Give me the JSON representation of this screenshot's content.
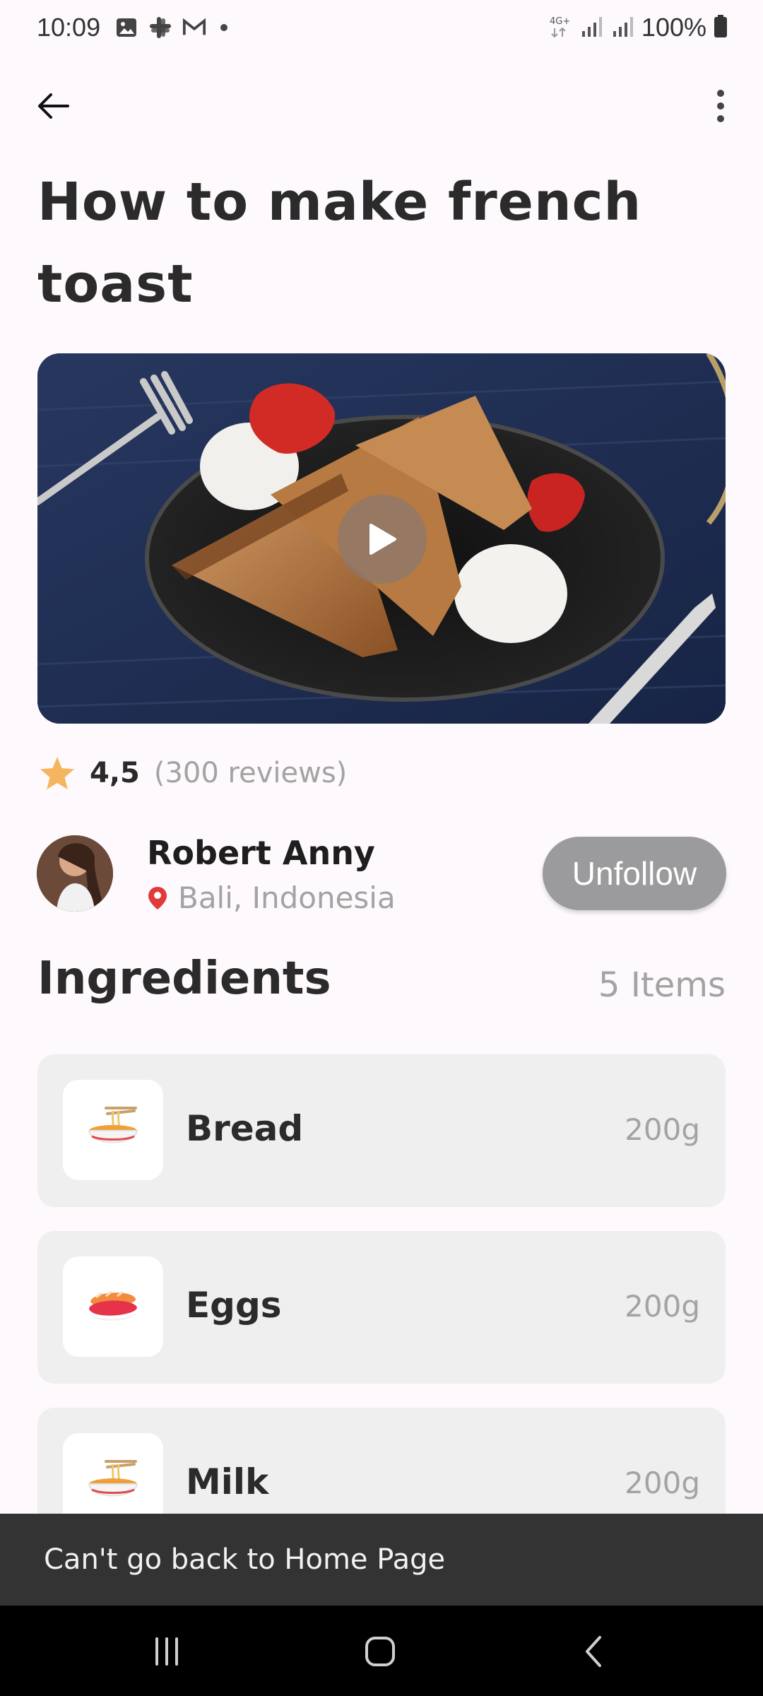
{
  "status_bar": {
    "time": "10:09",
    "left_icons": [
      "image-icon",
      "slack-icon",
      "gmail-icon",
      "dot-icon"
    ],
    "network": "4G+",
    "battery": "100%"
  },
  "recipe": {
    "title": "How to make french toast",
    "rating": "4,5",
    "reviews": "(300 reviews)"
  },
  "author": {
    "name": "Robert Anny",
    "location": "Bali, Indonesia",
    "follow_label": "Unfollow"
  },
  "ingredients": {
    "title": "Ingredients",
    "count": "5 Items",
    "items": [
      {
        "name": "Bread",
        "qty": "200g",
        "icon": "noodle-bowl-icon"
      },
      {
        "name": "Eggs",
        "qty": "200g",
        "icon": "sushi-icon"
      },
      {
        "name": "Milk",
        "qty": "200g",
        "icon": "noodle-bowl-icon"
      }
    ]
  },
  "snackbar": {
    "message": "Can't go back to Home Page"
  },
  "colors": {
    "background": "#fdf9fc",
    "star": "#f4b55e",
    "pin": "#e03a3a",
    "unfollow_bg": "#9b9a9c",
    "card_bg": "#efefef"
  }
}
